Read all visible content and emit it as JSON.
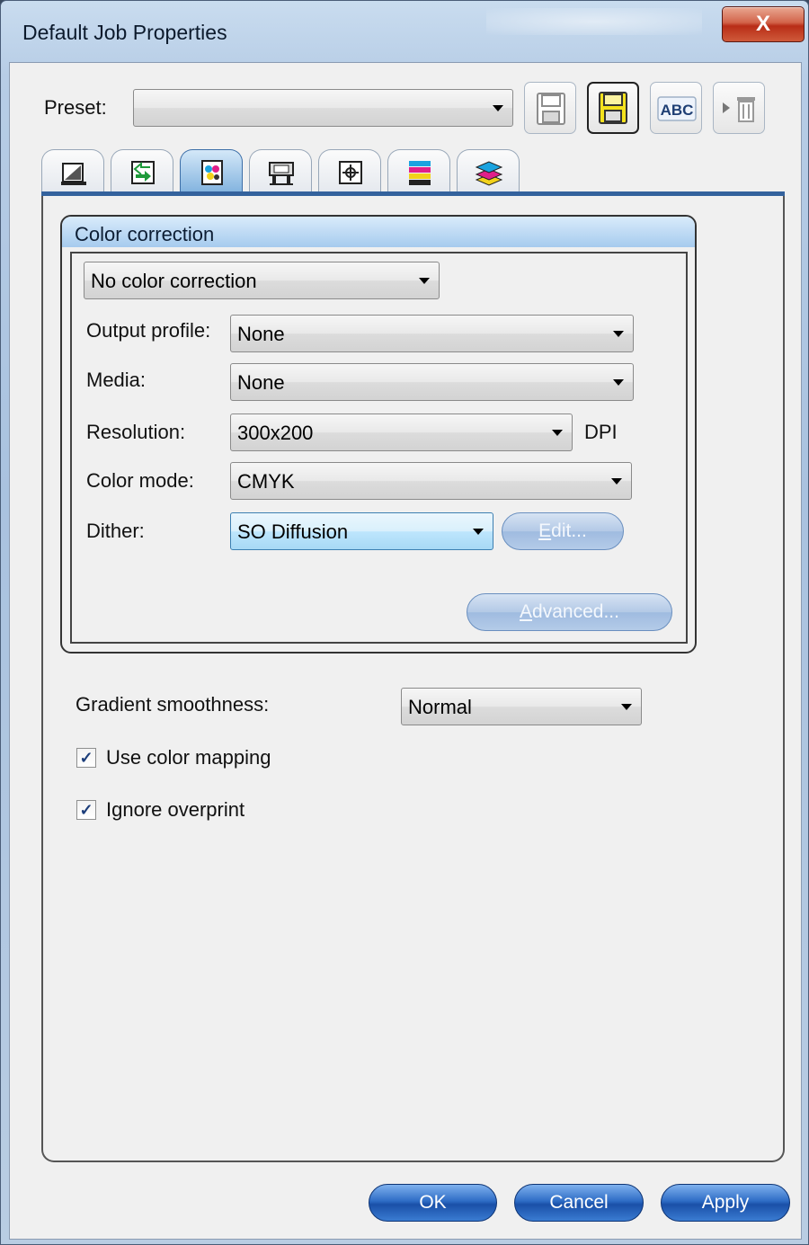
{
  "window": {
    "title": "Default Job Properties",
    "close_glyph": "X"
  },
  "preset": {
    "label": "Preset:",
    "value": ""
  },
  "toolbar": {
    "buttons": [
      {
        "icon": "save-icon"
      },
      {
        "icon": "save-as-icon"
      },
      {
        "icon": "rename-icon",
        "text": "ABC"
      },
      {
        "icon": "delete-icon"
      }
    ]
  },
  "tabs": [
    {
      "icon": "layout-icon",
      "active": false
    },
    {
      "icon": "transform-icon",
      "active": false
    },
    {
      "icon": "color-icon",
      "active": true
    },
    {
      "icon": "printer-icon",
      "active": false
    },
    {
      "icon": "crop-marks-icon",
      "active": false
    },
    {
      "icon": "color-bars-icon",
      "active": false
    },
    {
      "icon": "layers-icon",
      "active": false
    }
  ],
  "color_correction": {
    "heading": "Color correction",
    "mode": "No color correction",
    "output_profile": {
      "label": "Output profile:",
      "value": "None"
    },
    "media": {
      "label": "Media:",
      "value": "None"
    },
    "resolution": {
      "label": "Resolution:",
      "value": "300x200",
      "unit": "DPI"
    },
    "color_mode": {
      "label": "Color mode:",
      "value": "CMYK"
    },
    "dither": {
      "label": "Dither:",
      "value": "SO Diffusion"
    },
    "edit_button": {
      "label_underlined": "E",
      "label_rest": "dit..."
    },
    "advanced_button": {
      "label_underlined": "A",
      "label_rest": "dvanced..."
    }
  },
  "gradient": {
    "label": "Gradient smoothness:",
    "value": "Normal"
  },
  "options": [
    {
      "label": "Use color mapping",
      "checked": true
    },
    {
      "label": "Ignore overprint",
      "checked": true
    }
  ],
  "check_glyph": "✓",
  "footer": {
    "ok": "OK",
    "cancel": "Cancel",
    "apply": "Apply"
  }
}
